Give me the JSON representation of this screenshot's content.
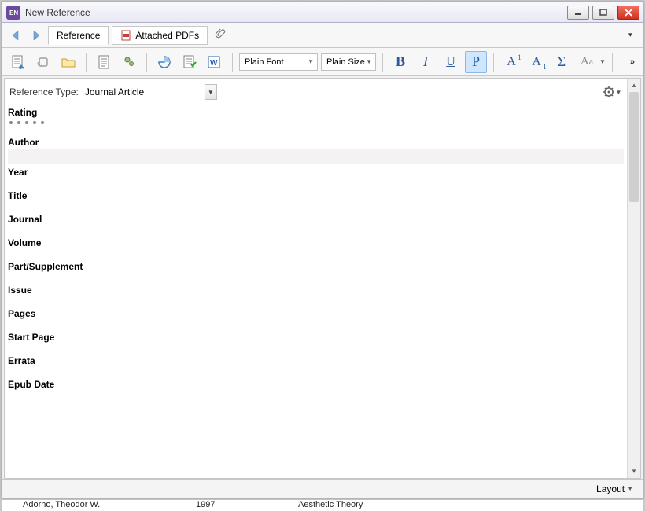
{
  "window": {
    "title": "New Reference"
  },
  "tabs": {
    "reference": "Reference",
    "attached_pdfs": "Attached PDFs"
  },
  "toolbar": {
    "font_label": "Plain Font",
    "size_label": "Plain Size",
    "bold": "B",
    "italic": "I",
    "underline": "U",
    "p": "P",
    "sup_a": "A",
    "sup_1": "1",
    "sub_a": "A",
    "sub_1": "1",
    "sigma": "Σ",
    "aa_big": "A",
    "aa_small": "a"
  },
  "reftype": {
    "label": "Reference Type:",
    "value": "Journal Article"
  },
  "fields": {
    "rating": "Rating",
    "author": "Author",
    "author_value": "",
    "year": "Year",
    "title": "Title",
    "journal": "Journal",
    "volume": "Volume",
    "part_supplement": "Part/Supplement",
    "issue": "Issue",
    "pages": "Pages",
    "start_page": "Start Page",
    "errata": "Errata",
    "epub_date": "Epub Date"
  },
  "statusbar": {
    "layout": "Layout"
  },
  "hidden_row": {
    "c1": "Adorno, Theodor W.",
    "c2": "1997",
    "c3": "Aesthetic Theory"
  }
}
